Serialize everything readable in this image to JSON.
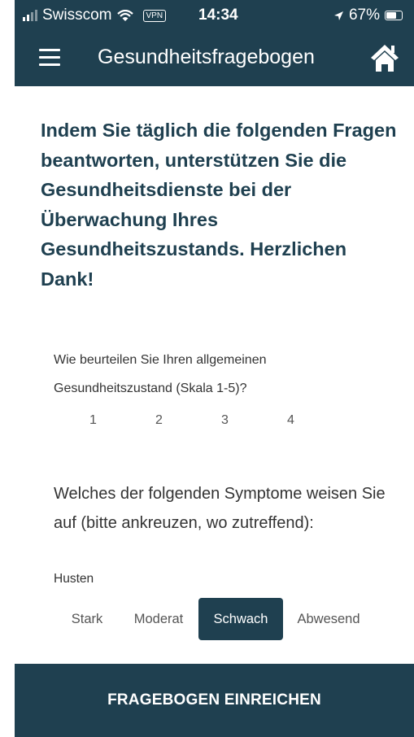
{
  "status_bar": {
    "carrier": "Swisscom",
    "vpn": "VPN",
    "time": "14:34",
    "battery": "67%"
  },
  "app_bar": {
    "title": "Gesundheitsfragebogen"
  },
  "intro": "Indem Sie täglich die folgenden Fragen beantworten, unterstützen Sie die Gesundheitsdienste bei der Überwachung Ihres Gesundheitszustands. Herzlichen Dank!",
  "question1": {
    "label": "Wie beurteilen Sie Ihren allgemeinen Gesundheitszustand (Skala 1-5)?",
    "options": [
      "1",
      "2",
      "3",
      "4"
    ]
  },
  "question2": {
    "label": "Welches der folgenden Symptome weisen Sie auf (bitte ankreuzen, wo zutreffend):",
    "symptom": "Husten",
    "options": [
      "Stark",
      "Moderat",
      "Schwach",
      "Abwesend"
    ],
    "selected": "Schwach"
  },
  "submit_label": "FRAGEBOGEN EINREICHEN",
  "colors": {
    "primary": "#1f4050",
    "background": "#ffffff"
  },
  "icons": {
    "menu": "hamburger-menu-icon",
    "home": "home-icon",
    "wifi": "wifi-icon",
    "location": "location-arrow-icon",
    "battery": "battery-icon"
  }
}
